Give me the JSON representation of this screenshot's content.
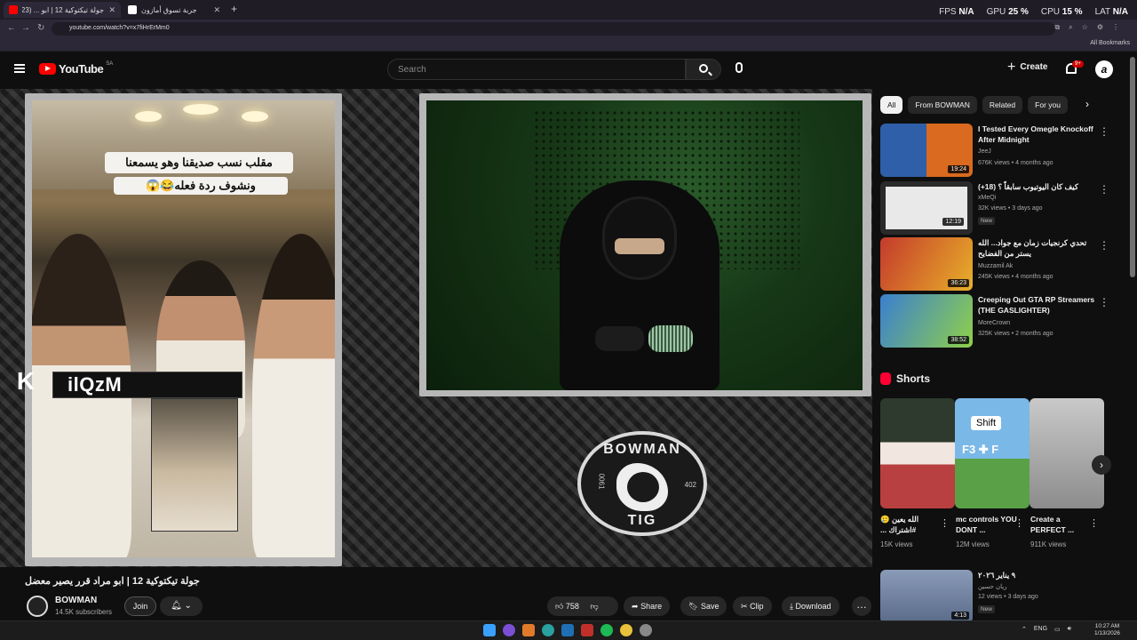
{
  "browser": {
    "tabs": [
      {
        "title": "جولة تيكتوكية 12 | ابو ... (123)",
        "active": true
      },
      {
        "title": "جربة تسوق أمازون",
        "active": false
      }
    ],
    "url": "youtube.com/watch?v=x7fiHrErMm0",
    "bookmarks_label": "All Bookmarks",
    "perf": {
      "fps_label": "FPS",
      "fps": "N/A",
      "gpu_label": "GPU",
      "gpu": "25 %",
      "cpu_label": "CPU",
      "cpu": "15 %",
      "lat_label": "LAT",
      "lat": "N/A"
    }
  },
  "header": {
    "logo": "YouTube",
    "country": "SA",
    "search_placeholder": "Search",
    "create_label": "Create",
    "notifications": "9+",
    "avatar_letter": "a"
  },
  "video": {
    "overlay_caption_line1": "مقلب نسب صديقنا وهو يسمعنا",
    "overlay_caption_line2": "ونشوف ردة فعله😂😱",
    "nametag": "ilQzM",
    "emblem_top": "BOWMAN",
    "emblem_bottom": "TIG",
    "emblem_left_num": "0061",
    "emblem_right_num": "402",
    "title": "جولة تيكتوكية 12 | ابو مراد قرر يصير معضل",
    "channel": "BOWMAN",
    "subscribers": "14.5K subscribers",
    "join_label": "Join",
    "likes": "758",
    "share_label": "Share",
    "save_label": "Save",
    "clip_label": "Clip",
    "download_label": "Download"
  },
  "sidebar": {
    "chips": [
      "All",
      "From BOWMAN",
      "Related",
      "For you"
    ],
    "recommendations": [
      {
        "title": "I Tested Every Omegle Knockoff After Midnight",
        "channel": "JeeJ",
        "meta": "676K views • 4 months ago",
        "duration": "19:24",
        "thumb_color": "#d96a1f"
      },
      {
        "title": "كيف كان اليوتيوب سابقاً ؟ (18+)",
        "channel": "xMeQi",
        "meta": "32K views • 3 days ago",
        "badge": "New",
        "duration": "12:19",
        "thumb_color": "#e9e9e9"
      },
      {
        "title": "تحدي كرنجيات زمان مع جواد... الله يستر من الفضايح",
        "channel": "Muzzamil Ak",
        "meta": "245K views • 4 months ago",
        "duration": "36:23",
        "thumb_color": "#c43a2b"
      },
      {
        "title": "Creeping Out GTA RP Streamers (THE GASLIGHTER)",
        "channel": "MoreCrown",
        "meta": "325K views • 2 months ago",
        "duration": "38:52",
        "thumb_color": "#3a7fd0"
      }
    ],
    "shorts_title": "Shorts",
    "shorts": [
      {
        "title": "الله يعين 🥲 #اشتراك ...",
        "views": "15K views",
        "color": "#2d2d2d"
      },
      {
        "title": "mc controls YOU DONT ...",
        "views": "12M views",
        "color": "#7ab8e8",
        "overlay": "Shift",
        "keys": "F3 ✚ F"
      },
      {
        "title": "Create a PERFECT ...",
        "views": "911K views",
        "color": "#a8a8a8"
      }
    ],
    "last": {
      "title": "٩ يناير ٢٠٢٦",
      "channel": "ريان حسين",
      "meta": "12 views • 3 days ago",
      "badge": "New",
      "duration": "4:13",
      "thumb_color": "#5a6b8a"
    }
  },
  "taskbar": {
    "lang": "ENG",
    "time": "10:27 AM",
    "date": "1/13/2026"
  }
}
